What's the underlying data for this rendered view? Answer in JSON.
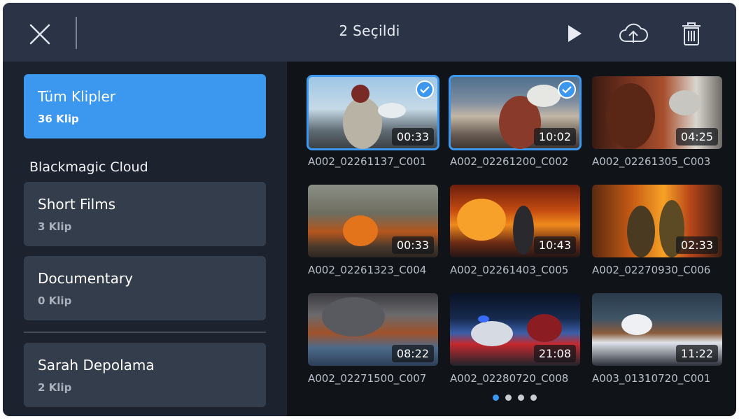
{
  "header": {
    "title": "2 Seçildi"
  },
  "sidebar": {
    "all_clips": {
      "title": "Tüm Klipler",
      "count": "36 Klip"
    },
    "cloud_section": "Blackmagic Cloud",
    "cloud_items": [
      {
        "title": "Short Films",
        "count": "3 Klip"
      },
      {
        "title": "Documentary",
        "count": "0 Klip"
      }
    ],
    "storage": {
      "title": "Sarah Depolama",
      "count": "2 Klip"
    }
  },
  "clips": [
    {
      "name": "A002_02261137_C001",
      "duration": "00:33",
      "selected": true
    },
    {
      "name": "A002_02261200_C002",
      "duration": "10:02",
      "selected": true
    },
    {
      "name": "A002_02261305_C003",
      "duration": "04:25",
      "selected": false
    },
    {
      "name": "A002_02261323_C004",
      "duration": "00:33",
      "selected": false
    },
    {
      "name": "A002_02261403_C005",
      "duration": "10:43",
      "selected": false
    },
    {
      "name": "A002_02270930_C006",
      "duration": "02:33",
      "selected": false
    },
    {
      "name": "A002_02271500_C007",
      "duration": "08:22",
      "selected": false
    },
    {
      "name": "A002_02280720_C008",
      "duration": "21:08",
      "selected": false
    },
    {
      "name": "A003_01310720_C001",
      "duration": "11:22",
      "selected": false
    }
  ],
  "pagination": {
    "pages": 4,
    "current": 1
  },
  "colors": {
    "accent": "#3c97ef",
    "topbar": "#2b3446",
    "sidebar": "#1d232e",
    "background": "#101418"
  },
  "icons": {
    "close": "close-icon",
    "play": "play-icon",
    "upload": "cloud-upload-icon",
    "delete": "trash-icon",
    "selected": "checkmark-icon"
  }
}
